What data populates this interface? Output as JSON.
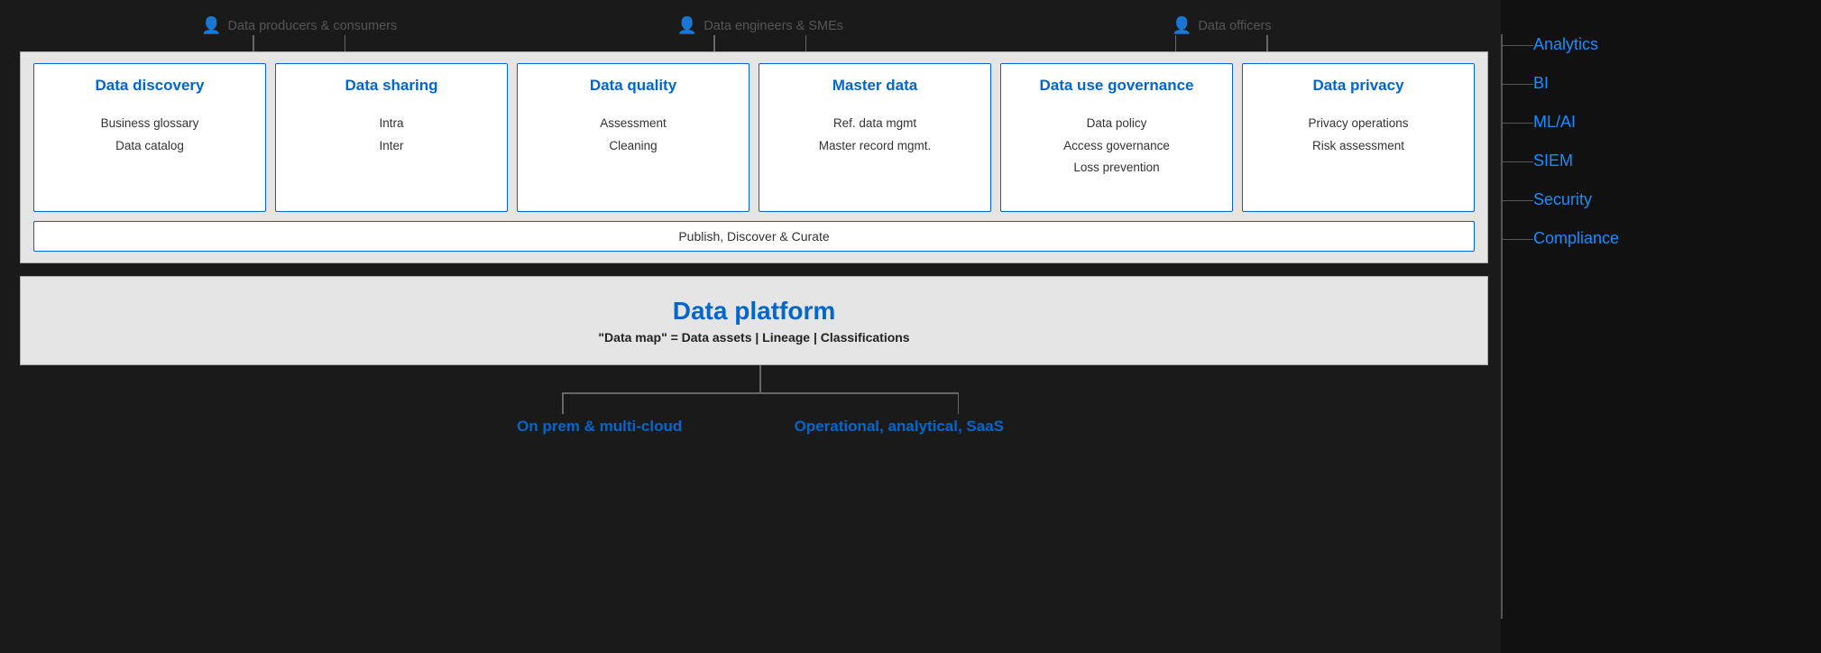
{
  "personas": [
    {
      "label": "Data producers & consumers",
      "connectors": 2
    },
    {
      "label": "Data engineers & SMEs",
      "connectors": 2
    },
    {
      "label": "Data officers",
      "connectors": 2
    }
  ],
  "cards": [
    {
      "title": "Data discovery",
      "items": [
        "Business glossary",
        "Data catalog"
      ]
    },
    {
      "title": "Data sharing",
      "items": [
        "Intra",
        "Inter"
      ]
    },
    {
      "title": "Data quality",
      "items": [
        "Assessment",
        "Cleaning"
      ]
    },
    {
      "title": "Master data",
      "items": [
        "Ref. data mgmt",
        "Master record mgmt."
      ]
    },
    {
      "title": "Data use governance",
      "items": [
        "Data policy",
        "Access governance",
        "Loss prevention"
      ]
    },
    {
      "title": "Data privacy",
      "items": [
        "Privacy operations",
        "Risk assessment"
      ]
    }
  ],
  "publish_bar": "Publish, Discover & Curate",
  "platform": {
    "title": "Data platform",
    "subtitle": "\"Data map\" = Data assets | Lineage | Classifications"
  },
  "bottom_sources": [
    "On prem & multi-cloud",
    "Operational, analytical, SaaS"
  ],
  "sidebar": {
    "items": [
      "Analytics",
      "BI",
      "ML/AI",
      "SIEM",
      "Security",
      "Compliance"
    ]
  },
  "colors": {
    "blue": "#0066cc",
    "sidebar_blue": "#1a8cff",
    "dark_bg": "#1a1a1a",
    "light_bg": "#e5e5e5",
    "border_gray": "#999999",
    "text_dark": "#333333",
    "text_medium": "#555555"
  }
}
